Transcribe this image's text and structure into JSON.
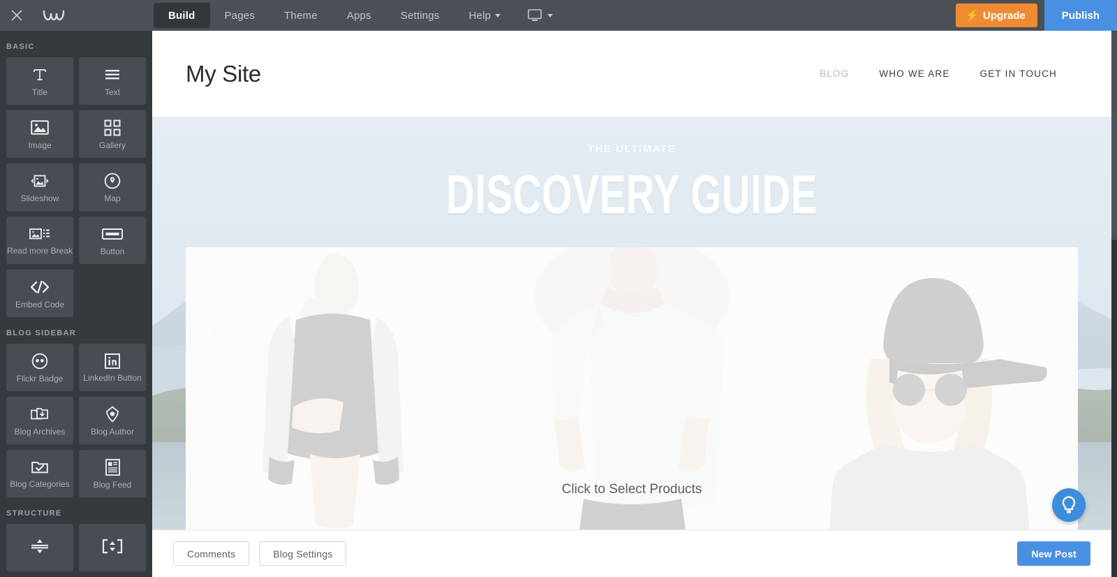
{
  "topbar": {
    "close_icon": "close-icon",
    "logo_icon": "weebly-logo-icon",
    "items": [
      {
        "label": "Build",
        "active": true,
        "caret": false
      },
      {
        "label": "Pages",
        "active": false,
        "caret": false
      },
      {
        "label": "Theme",
        "active": false,
        "caret": false
      },
      {
        "label": "Apps",
        "active": false,
        "caret": false
      },
      {
        "label": "Settings",
        "active": false,
        "caret": false
      },
      {
        "label": "Help",
        "active": false,
        "caret": true
      }
    ],
    "device_icon": "desktop-monitor-icon",
    "upgrade_label": "Upgrade",
    "upgrade_icon": "lightning-bolt-icon",
    "upgrade_color": "#ef8b33",
    "publish_label": "Publish",
    "publish_color": "#4a90e2",
    "background_color": "#4a5055"
  },
  "sidebar": {
    "background_color": "#353a3e",
    "sections": [
      {
        "heading": "BASIC",
        "items": [
          {
            "label": "Title",
            "icon": "title-T-icon"
          },
          {
            "label": "Text",
            "icon": "text-lines-icon"
          },
          {
            "label": "Image",
            "icon": "image-icon"
          },
          {
            "label": "Gallery",
            "icon": "gallery-grid-icon"
          },
          {
            "label": "Slideshow",
            "icon": "slideshow-icon"
          },
          {
            "label": "Map",
            "icon": "map-pin-icon"
          },
          {
            "label": "Read more Break",
            "icon": "read-more-break-icon"
          },
          {
            "label": "Button",
            "icon": "button-icon"
          },
          {
            "label": "Embed Code",
            "icon": "embed-code-icon"
          }
        ]
      },
      {
        "heading": "BLOG SIDEBAR",
        "items": [
          {
            "label": "Flickr Badge",
            "icon": "flickr-badge-icon"
          },
          {
            "label": "LinkedIn Button",
            "icon": "linkedin-button-icon"
          },
          {
            "label": "Blog Archives",
            "icon": "blog-archives-icon"
          },
          {
            "label": "Blog Author",
            "icon": "blog-author-icon"
          },
          {
            "label": "Blog Categories",
            "icon": "blog-categories-icon"
          },
          {
            "label": "Blog Feed",
            "icon": "blog-feed-icon"
          }
        ]
      },
      {
        "heading": "STRUCTURE",
        "items": [
          {
            "label": "",
            "icon": "spacer-divider-icon"
          },
          {
            "label": "",
            "icon": "pocket-icon"
          }
        ]
      }
    ]
  },
  "site": {
    "title": "My Site",
    "nav": [
      {
        "label": "BLOG",
        "dim": true
      },
      {
        "label": "WHO WE ARE",
        "dim": false
      },
      {
        "label": "GET IN TOUCH",
        "dim": false
      }
    ],
    "hero": {
      "kicker": "THE ULTIMATE",
      "title": "DISCOVERY GUIDE"
    },
    "products_placeholder": "Click to Select Products"
  },
  "bottombar": {
    "comments_label": "Comments",
    "blog_settings_label": "Blog Settings",
    "new_post_label": "New Post",
    "new_post_color": "#4a90e2"
  },
  "help_fab": {
    "icon": "lightbulb-icon",
    "color": "#3d8ddd"
  }
}
